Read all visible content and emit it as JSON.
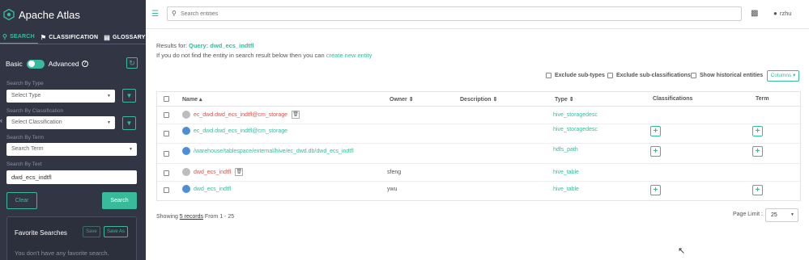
{
  "brand": {
    "name": "Apache Atlas"
  },
  "nav": {
    "tabs": [
      {
        "label": "SEARCH",
        "icon": "search-icon"
      },
      {
        "label": "CLASSIFICATION",
        "icon": "tag-icon"
      },
      {
        "label": "GLOSSARY",
        "icon": "book-icon"
      }
    ]
  },
  "sidebar": {
    "mode": {
      "basic": "Basic",
      "advanced": "Advanced"
    },
    "type": {
      "label": "Search By Type",
      "placeholder": "Select Type"
    },
    "classification": {
      "label": "Search By Classification",
      "placeholder": "Select Classification"
    },
    "term": {
      "label": "Search By Term",
      "placeholder": "Search Term"
    },
    "text": {
      "label": "Search By Text",
      "value": "dwd_ecs_indtfl"
    },
    "clear": "Clear",
    "search": "Search",
    "favorites": {
      "title": "Favorite Searches",
      "save": "Save",
      "save_as": "Save As",
      "empty": "You don't have any favorite search."
    }
  },
  "topbar": {
    "search_placeholder": "Search entities",
    "user": "rzhu"
  },
  "main": {
    "results_prefix": "Results for: ",
    "results_query": "Query: dwd_ecs_indtfl",
    "hint_text": "If you do not find the entity in search result below then you can ",
    "hint_link": "create new entity",
    "options": {
      "exclude_sub_types": "Exclude sub-types",
      "exclude_sub_classifications": "Exclude sub-classifications",
      "show_historical": "Show historical entities"
    },
    "columns_btn": "Columns ▾",
    "headers": {
      "name": "Name ▴",
      "owner": "Owner ⇕",
      "description": "Description ⇕",
      "type": "Type ⇕",
      "classifications": "Classifications",
      "term": "Term"
    },
    "rows": [
      {
        "name": "ec_dwd.dwd_ecs_indtfl@cm_storage",
        "owner": "",
        "type": "hive_storagedesc"
      },
      {
        "name": "ec_dwd.dwd_ecs_indtfl@cm_storage",
        "owner": "",
        "type": "hive_storagedesc"
      },
      {
        "name": "/warehouse/tablespace/external/hive/ec_dwd.db/dwd_ecs_indtfl",
        "owner": "",
        "type": "hdfs_path"
      },
      {
        "name": "dwd_ecs_indtfl",
        "owner": "sfeng",
        "type": "hive_table"
      },
      {
        "name": "dwd_ecs_indtfl",
        "owner": "ywu",
        "type": "hive_table"
      }
    ],
    "showing_prefix": "Showing ",
    "showing_records": "5 records",
    "showing_suffix": " From 1 - 25",
    "page_limit_label": "Page Limit :",
    "page_limit_value": "25"
  },
  "colors": {
    "accent": "#37bb9b",
    "sidebar_bg": "#323544",
    "deleted": "#d9534f"
  }
}
